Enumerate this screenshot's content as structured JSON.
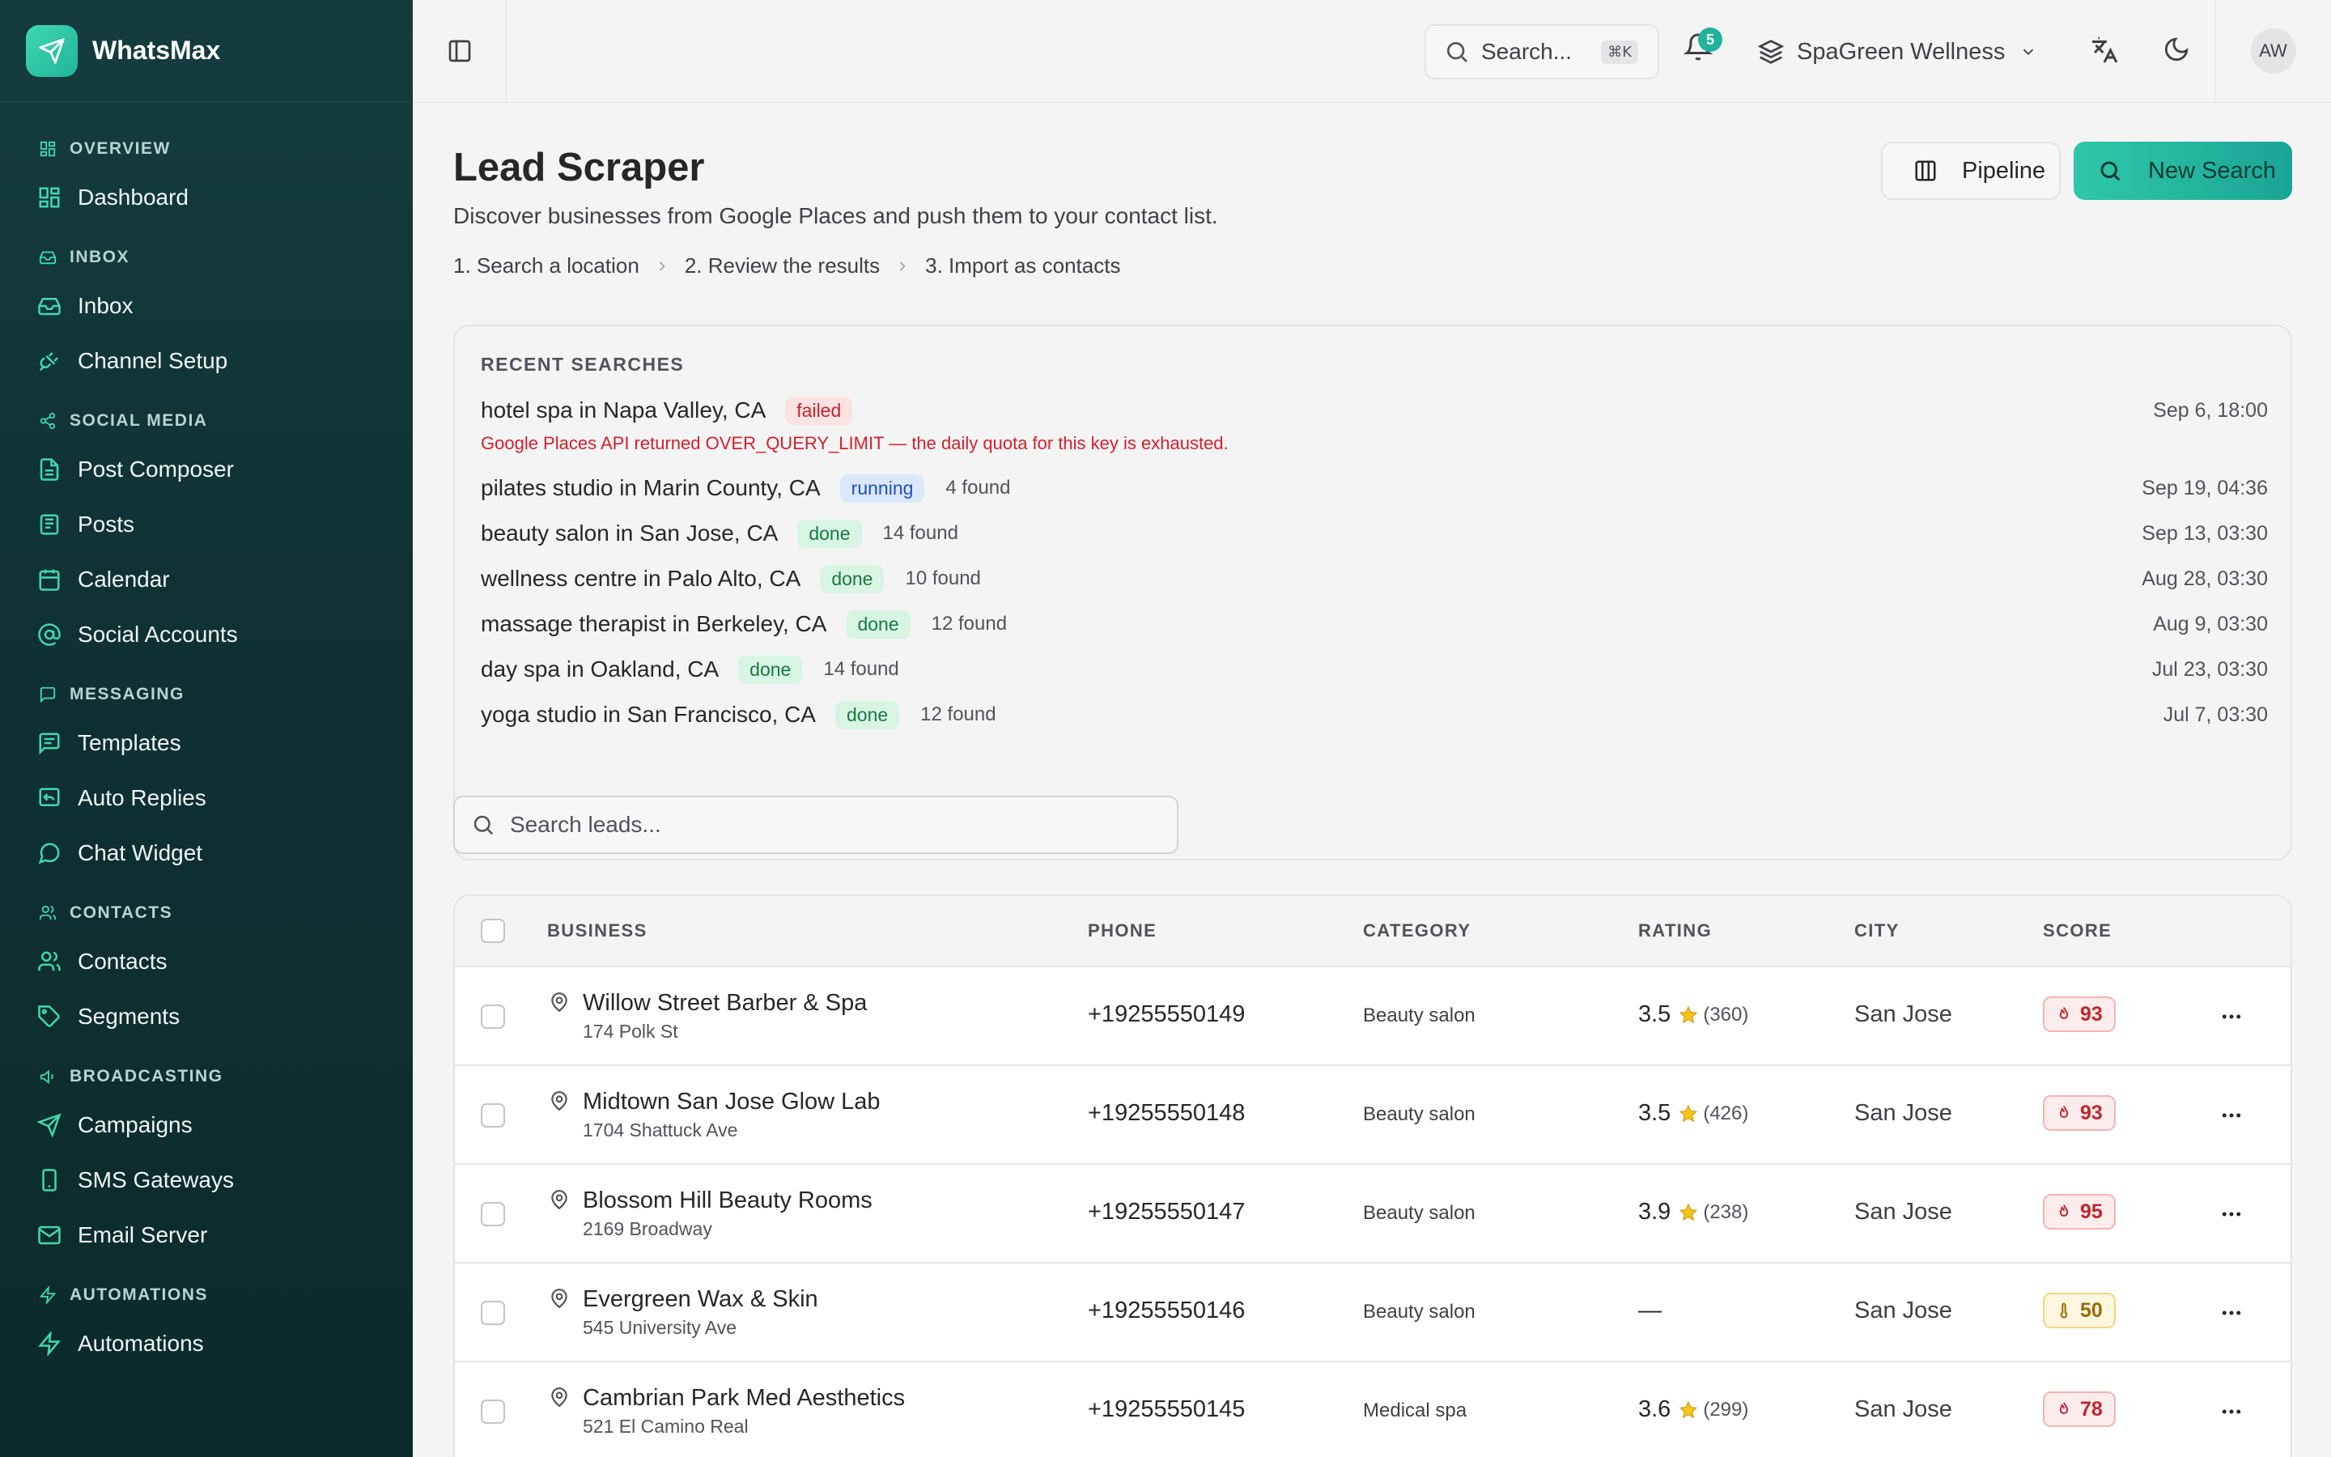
{
  "app": {
    "name": "WhatsMax"
  },
  "sidebar": {
    "sections": [
      {
        "label": "OVERVIEW",
        "icon": "grid-icon",
        "items": [
          {
            "label": "Dashboard",
            "icon": "dashboard-icon"
          }
        ]
      },
      {
        "label": "INBOX",
        "icon": "inbox-icon",
        "items": [
          {
            "label": "Inbox",
            "icon": "inbox-icon"
          },
          {
            "label": "Channel Setup",
            "icon": "plug-icon"
          }
        ]
      },
      {
        "label": "SOCIAL MEDIA",
        "icon": "share-icon",
        "items": [
          {
            "label": "Post Composer",
            "icon": "document-icon"
          },
          {
            "label": "Posts",
            "icon": "newspaper-icon"
          },
          {
            "label": "Calendar",
            "icon": "calendar-icon"
          },
          {
            "label": "Social Accounts",
            "icon": "at-sign-icon"
          }
        ]
      },
      {
        "label": "MESSAGING",
        "icon": "message-square-icon",
        "items": [
          {
            "label": "Templates",
            "icon": "message-text-icon"
          },
          {
            "label": "Auto Replies",
            "icon": "reply-icon"
          },
          {
            "label": "Chat Widget",
            "icon": "chat-bubble-icon"
          }
        ]
      },
      {
        "label": "CONTACTS",
        "icon": "users-icon",
        "items": [
          {
            "label": "Contacts",
            "icon": "users-icon"
          },
          {
            "label": "Segments",
            "icon": "tag-icon"
          }
        ]
      },
      {
        "label": "BROADCASTING",
        "icon": "megaphone-icon",
        "items": [
          {
            "label": "Campaigns",
            "icon": "send-icon"
          },
          {
            "label": "SMS Gateways",
            "icon": "phone-icon"
          },
          {
            "label": "Email Server",
            "icon": "mail-icon"
          }
        ]
      },
      {
        "label": "AUTOMATIONS",
        "icon": "zap-icon",
        "items": [
          {
            "label": "Automations",
            "icon": "zap-icon"
          }
        ]
      }
    ]
  },
  "topbar": {
    "search_placeholder": "Search...",
    "search_shortcut": "⌘K",
    "notifications_count": "5",
    "workspace": "SpaGreen Wellness",
    "avatar_initials": "AW"
  },
  "page": {
    "title": "Lead Scraper",
    "subtitle": "Discover businesses from Google Places and push them to your contact list.",
    "steps": [
      "1. Search a location",
      "2. Review the results",
      "3. Import as contacts"
    ],
    "pipeline_label": "Pipeline",
    "new_search_label": "New Search"
  },
  "recent": {
    "title": "RECENT SEARCHES",
    "error": "Google Places API returned OVER_QUERY_LIMIT — the daily quota for this key is exhausted.",
    "rows": [
      {
        "query": "hotel spa in Napa Valley, CA",
        "status": "failed",
        "found": "",
        "date": "Sep 6, 18:00"
      },
      {
        "query": "pilates studio in Marin County, CA",
        "status": "running",
        "found": "4 found",
        "date": "Sep 19, 04:36"
      },
      {
        "query": "beauty salon in San Jose, CA",
        "status": "done",
        "found": "14 found",
        "date": "Sep 13, 03:30"
      },
      {
        "query": "wellness centre in Palo Alto, CA",
        "status": "done",
        "found": "10 found",
        "date": "Aug 28, 03:30"
      },
      {
        "query": "massage therapist in Berkeley, CA",
        "status": "done",
        "found": "12 found",
        "date": "Aug 9, 03:30"
      },
      {
        "query": "day spa in Oakland, CA",
        "status": "done",
        "found": "14 found",
        "date": "Jul 23, 03:30"
      },
      {
        "query": "yoga studio in San Francisco, CA",
        "status": "done",
        "found": "12 found",
        "date": "Jul 7, 03:30"
      }
    ]
  },
  "leads": {
    "search_placeholder": "Search leads...",
    "columns": [
      "BUSINESS",
      "PHONE",
      "CATEGORY",
      "RATING",
      "CITY",
      "SCORE"
    ],
    "rows": [
      {
        "name": "Willow Street Barber & Spa",
        "address": "174 Polk St",
        "phone": "+19255550149",
        "category": "Beauty salon",
        "rating": "3.5",
        "reviews": "(360)",
        "city": "San Jose",
        "score": "93",
        "score_level": "hot"
      },
      {
        "name": "Midtown San Jose Glow Lab",
        "address": "1704 Shattuck Ave",
        "phone": "+19255550148",
        "category": "Beauty salon",
        "rating": "3.5",
        "reviews": "(426)",
        "city": "San Jose",
        "score": "93",
        "score_level": "hot"
      },
      {
        "name": "Blossom Hill Beauty Rooms",
        "address": "2169 Broadway",
        "phone": "+19255550147",
        "category": "Beauty salon",
        "rating": "3.9",
        "reviews": "(238)",
        "city": "San Jose",
        "score": "95",
        "score_level": "hot"
      },
      {
        "name": "Evergreen Wax & Skin",
        "address": "545 University Ave",
        "phone": "+19255550146",
        "category": "Beauty salon",
        "rating": "—",
        "reviews": "",
        "city": "San Jose",
        "score": "50",
        "score_level": "warm"
      },
      {
        "name": "Cambrian Park Med Aesthetics",
        "address": "521 El Camino Real",
        "phone": "+19255550145",
        "category": "Medical spa",
        "rating": "3.6",
        "reviews": "(299)",
        "city": "San Jose",
        "score": "78",
        "score_level": "hot"
      }
    ]
  },
  "colors": {
    "accent": "#2fc7a9",
    "sidebar": "#0f3133",
    "hot": "#c0262d",
    "warm": "#9a6a00"
  }
}
